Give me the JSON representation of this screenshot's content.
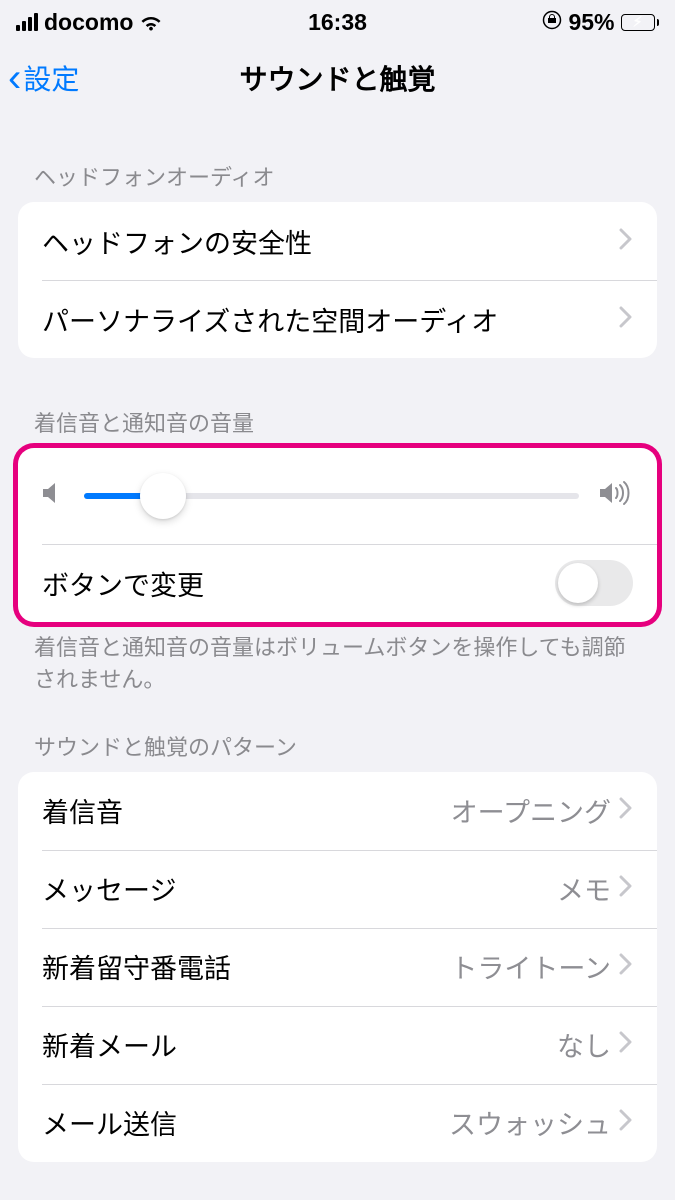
{
  "status": {
    "carrier": "docomo",
    "time": "16:38",
    "battery_pct": "95%"
  },
  "nav": {
    "back_label": "設定",
    "title": "サウンドと触覚"
  },
  "sections": {
    "headphone": {
      "header": "ヘッドフォンオーディオ",
      "items": [
        {
          "label": "ヘッドフォンの安全性"
        },
        {
          "label": "パーソナライズされた空間オーディオ"
        }
      ]
    },
    "volume": {
      "header": "着信音と通知音の音量",
      "slider_pct": 16,
      "toggle_label": "ボタンで変更",
      "toggle_on": false,
      "footer": "着信音と通知音の音量はボリュームボタンを操作しても調節されません。"
    },
    "patterns": {
      "header": "サウンドと触覚のパターン",
      "items": [
        {
          "label": "着信音",
          "value": "オープニング"
        },
        {
          "label": "メッセージ",
          "value": "メモ"
        },
        {
          "label": "新着留守番電話",
          "value": "トライトーン"
        },
        {
          "label": "新着メール",
          "value": "なし"
        },
        {
          "label": "メール送信",
          "value": "スウォッシュ"
        }
      ]
    }
  }
}
